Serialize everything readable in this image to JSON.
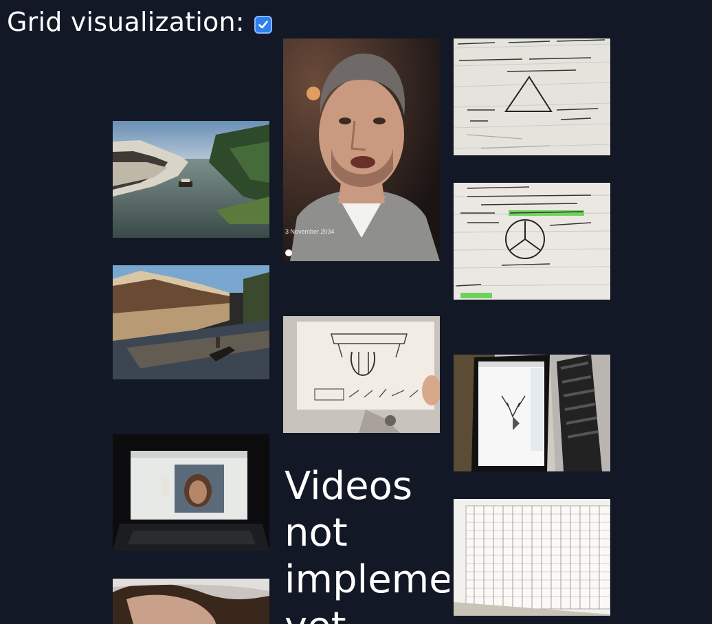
{
  "header": {
    "label": "Grid visualization:",
    "checkbox_checked": true,
    "accent_color": "#2f7ff0"
  },
  "tiles": [
    {
      "name": "photo-canal-boat"
    },
    {
      "name": "photo-canal-houses"
    },
    {
      "name": "photo-laptop-video-call"
    },
    {
      "name": "photo-selfie-hair"
    },
    {
      "name": "photo-man-portrait",
      "caption": "3 November 2034"
    },
    {
      "name": "photo-bridge-drawing-card"
    },
    {
      "name": "photo-notes-triangle"
    },
    {
      "name": "photo-notes-representation"
    },
    {
      "name": "photo-laptop-deer-drawing"
    },
    {
      "name": "photo-paper-grid-table"
    }
  ],
  "video_placeholder": {
    "line1": "Videos",
    "line2": "not",
    "line3": "implemented",
    "line4": "yet"
  },
  "colors": {
    "background": "#131826",
    "text": "#ffffff"
  }
}
